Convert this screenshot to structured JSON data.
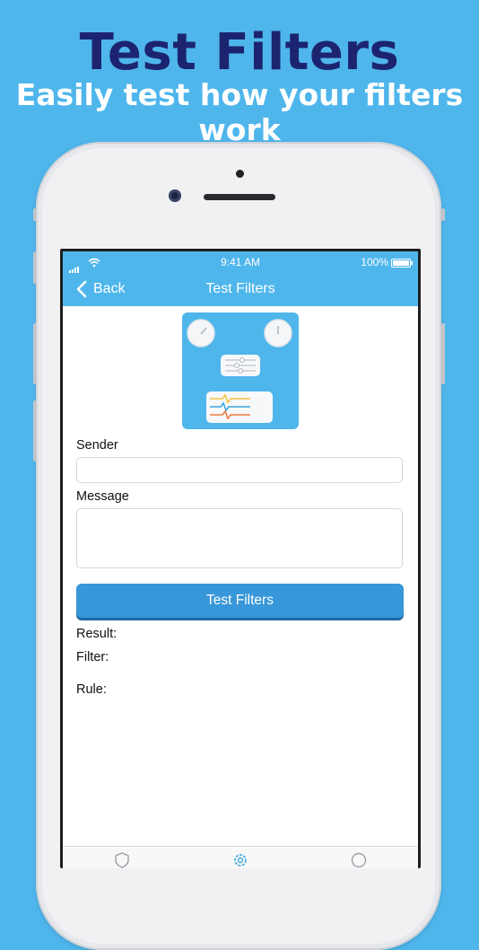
{
  "promo": {
    "headline": "Test Filters",
    "subheadline": "Easily test how your filters work"
  },
  "status_bar": {
    "time": "9:41 AM",
    "battery": "100%"
  },
  "nav": {
    "back_label": "Back",
    "title": "Test Filters"
  },
  "form": {
    "sender_label": "Sender",
    "sender_value": "",
    "message_label": "Message",
    "message_value": "",
    "submit_label": "Test Filters"
  },
  "results": {
    "result_label": "Result:",
    "filter_label": "Filter:",
    "rule_label": "Rule:"
  },
  "colors": {
    "background": "#4fb6ec",
    "headline": "#1c2470",
    "button": "#3797d9"
  },
  "tab_icons": [
    "shield-icon",
    "gear-icon",
    "info-icon"
  ]
}
